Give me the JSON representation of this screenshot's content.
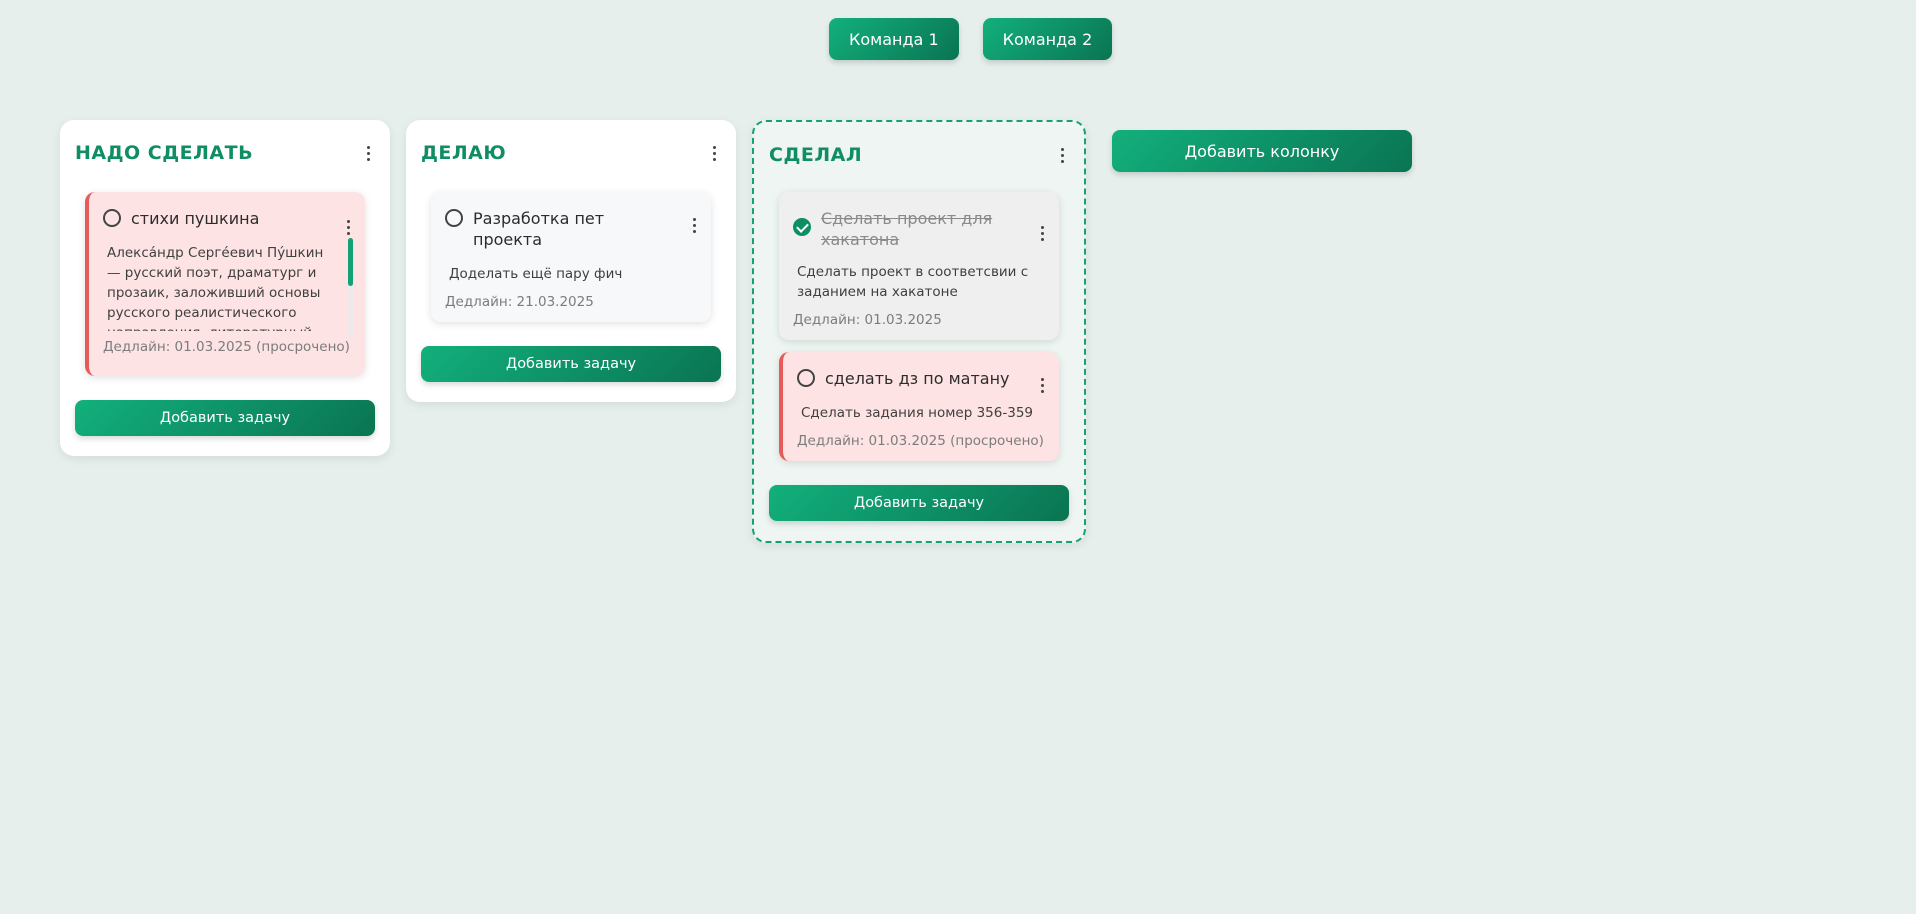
{
  "teams": [
    "Команда 1",
    "Команда 2"
  ],
  "add_column_label": "Добавить колонку",
  "add_task_label": "Добавить задачу",
  "colors": {
    "accent": "#0f8e62",
    "overdue_bg": "#fde3e3",
    "overdue_border": "#e65a5a"
  },
  "columns": [
    {
      "title": "НАДО СДЕЛАТЬ",
      "tasks": [
        {
          "title": "стихи пушкина",
          "description": "Алекса́ндр Серге́евич Пу́шкин — русский поэт, драматург и прозаик, заложивший основы русского реалистического направления, литературный критик и теоретик литературы",
          "deadline": "Дедлайн: 01.03.2025 (просрочено)",
          "done": false,
          "overdue": true
        }
      ]
    },
    {
      "title": "ДЕЛАЮ",
      "tasks": [
        {
          "title": "Разработка пет проекта",
          "description": "Доделать ещё пару фич",
          "deadline": "Дедлайн: 21.03.2025",
          "done": false,
          "overdue": false
        }
      ]
    },
    {
      "title": "СДЕЛАЛ",
      "tasks": [
        {
          "title": "Сделать проект для хакатона",
          "description": "Сделать проект в соответсвии с заданием на хакатоне",
          "deadline": "Дедлайн: 01.03.2025",
          "done": true,
          "overdue": false
        },
        {
          "title": "сделать дз по матану",
          "description": "Сделать задания номер 356-359",
          "deadline": "Дедлайн: 01.03.2025 (просрочено)",
          "done": false,
          "overdue": true
        }
      ]
    }
  ]
}
